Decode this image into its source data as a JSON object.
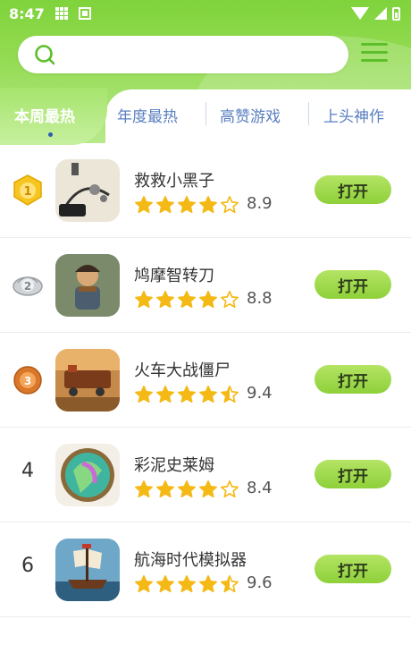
{
  "statusbar": {
    "time": "8:47"
  },
  "search": {
    "placeholder": ""
  },
  "tabs": [
    {
      "label": "本周最热",
      "active": true
    },
    {
      "label": "年度最热",
      "active": false
    },
    {
      "label": "高赞游戏",
      "active": false
    },
    {
      "label": "上头神作",
      "active": false
    }
  ],
  "colors": {
    "accent": "#8ed03a",
    "tab_text": "#5a7fc0",
    "star": "#f5b915"
  },
  "apps": [
    {
      "rank": "1",
      "rank_type": "gold-medal",
      "name": "救救小黑子",
      "stars": 4,
      "rating": "8.9",
      "button": "打开"
    },
    {
      "rank": "2",
      "rank_type": "silver-medal",
      "name": "鸠摩智转刀",
      "stars": 4,
      "rating": "8.8",
      "button": "打开"
    },
    {
      "rank": "3",
      "rank_type": "bronze-medal",
      "name": "火车大战僵尸",
      "stars": 4.5,
      "rating": "9.4",
      "button": "打开"
    },
    {
      "rank": "4",
      "rank_type": "number",
      "name": "彩泥史莱姆",
      "stars": 4,
      "rating": "8.4",
      "button": "打开"
    },
    {
      "rank": "6",
      "rank_type": "number",
      "name": "航海时代模拟器",
      "stars": 4.5,
      "rating": "9.6",
      "button": "打开"
    }
  ]
}
